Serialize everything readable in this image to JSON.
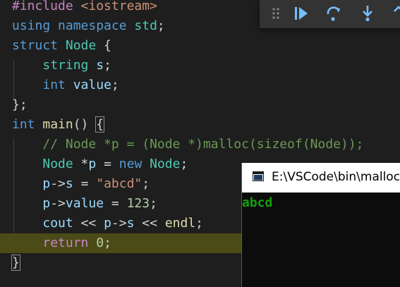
{
  "editor": {
    "lines": [
      {
        "tokens": [
          {
            "t": "#include ",
            "c": "include"
          },
          {
            "t": "<iostream>",
            "c": "string"
          }
        ]
      },
      {
        "tokens": [
          {
            "t": "using ",
            "c": "keyword"
          },
          {
            "t": "namespace ",
            "c": "keyword"
          },
          {
            "t": "std",
            "c": "type"
          },
          {
            "t": ";",
            "c": "plain"
          }
        ]
      },
      {
        "tokens": [
          {
            "t": "struct ",
            "c": "keyword"
          },
          {
            "t": "Node",
            "c": "type"
          },
          {
            "t": " {",
            "c": "plain"
          }
        ]
      },
      {
        "tokens": [
          {
            "t": "    ",
            "c": "plain"
          },
          {
            "t": "string",
            "c": "type"
          },
          {
            "t": " ",
            "c": "plain"
          },
          {
            "t": "s",
            "c": "variable"
          },
          {
            "t": ";",
            "c": "plain"
          }
        ]
      },
      {
        "tokens": [
          {
            "t": "    ",
            "c": "plain"
          },
          {
            "t": "int",
            "c": "keyword"
          },
          {
            "t": " ",
            "c": "plain"
          },
          {
            "t": "value",
            "c": "variable"
          },
          {
            "t": ";",
            "c": "plain"
          }
        ]
      },
      {
        "tokens": [
          {
            "t": "};",
            "c": "plain"
          }
        ]
      },
      {
        "tokens": [
          {
            "t": "int ",
            "c": "keyword"
          },
          {
            "t": "main",
            "c": "func"
          },
          {
            "t": "() ",
            "c": "plain"
          },
          {
            "t": "{",
            "c": "plain",
            "box": true
          }
        ]
      },
      {
        "tokens": [
          {
            "t": "    ",
            "c": "plain"
          },
          {
            "t": "// Node *p = (Node *)malloc(sizeof(Node));",
            "c": "comment"
          }
        ]
      },
      {
        "tokens": [
          {
            "t": "    ",
            "c": "plain"
          },
          {
            "t": "Node",
            "c": "type"
          },
          {
            "t": " *",
            "c": "plain"
          },
          {
            "t": "p",
            "c": "variable"
          },
          {
            "t": " = ",
            "c": "plain"
          },
          {
            "t": "new",
            "c": "keyword"
          },
          {
            "t": " ",
            "c": "plain"
          },
          {
            "t": "Node",
            "c": "type"
          },
          {
            "t": ";",
            "c": "plain"
          }
        ]
      },
      {
        "tokens": [
          {
            "t": "    ",
            "c": "plain"
          },
          {
            "t": "p",
            "c": "variable"
          },
          {
            "t": "->",
            "c": "plain"
          },
          {
            "t": "s",
            "c": "variable"
          },
          {
            "t": " = ",
            "c": "plain"
          },
          {
            "t": "\"abcd\"",
            "c": "string"
          },
          {
            "t": ";",
            "c": "plain"
          }
        ]
      },
      {
        "tokens": [
          {
            "t": "    ",
            "c": "plain"
          },
          {
            "t": "p",
            "c": "variable"
          },
          {
            "t": "->",
            "c": "plain"
          },
          {
            "t": "value",
            "c": "variable"
          },
          {
            "t": " = ",
            "c": "plain"
          },
          {
            "t": "123",
            "c": "number"
          },
          {
            "t": ";",
            "c": "plain"
          }
        ]
      },
      {
        "tokens": [
          {
            "t": "    ",
            "c": "plain"
          },
          {
            "t": "cout",
            "c": "variable"
          },
          {
            "t": " << ",
            "c": "plain"
          },
          {
            "t": "p",
            "c": "variable"
          },
          {
            "t": "->",
            "c": "plain"
          },
          {
            "t": "s",
            "c": "variable"
          },
          {
            "t": " << ",
            "c": "plain"
          },
          {
            "t": "endl",
            "c": "func"
          },
          {
            "t": ";",
            "c": "plain"
          }
        ]
      },
      {
        "tokens": [
          {
            "t": "    ",
            "c": "plain"
          },
          {
            "t": "return",
            "c": "control"
          },
          {
            "t": " ",
            "c": "plain"
          },
          {
            "t": "0",
            "c": "number"
          },
          {
            "t": ";",
            "c": "plain"
          }
        ],
        "current": true
      },
      {
        "tokens": [
          {
            "t": "}",
            "c": "plain",
            "box": true
          }
        ]
      }
    ]
  },
  "debug_toolbar": {
    "buttons": [
      {
        "name": "drag-handle-icon",
        "interactable": true
      },
      {
        "name": "continue-icon",
        "interactable": true
      },
      {
        "name": "step-over-icon",
        "interactable": true
      },
      {
        "name": "step-into-icon",
        "interactable": true
      },
      {
        "name": "step-out-icon",
        "interactable": true
      }
    ],
    "colors": {
      "icon": "#75beff",
      "grip": "#8a8a8a"
    }
  },
  "console": {
    "title": "E:\\VSCode\\bin\\malloc",
    "icon": "console-window-icon",
    "output": "abcd"
  },
  "colors": {
    "editor_background": "#1e1e1e",
    "current_line": "#4b4b18",
    "console_text": "#13a10e"
  }
}
